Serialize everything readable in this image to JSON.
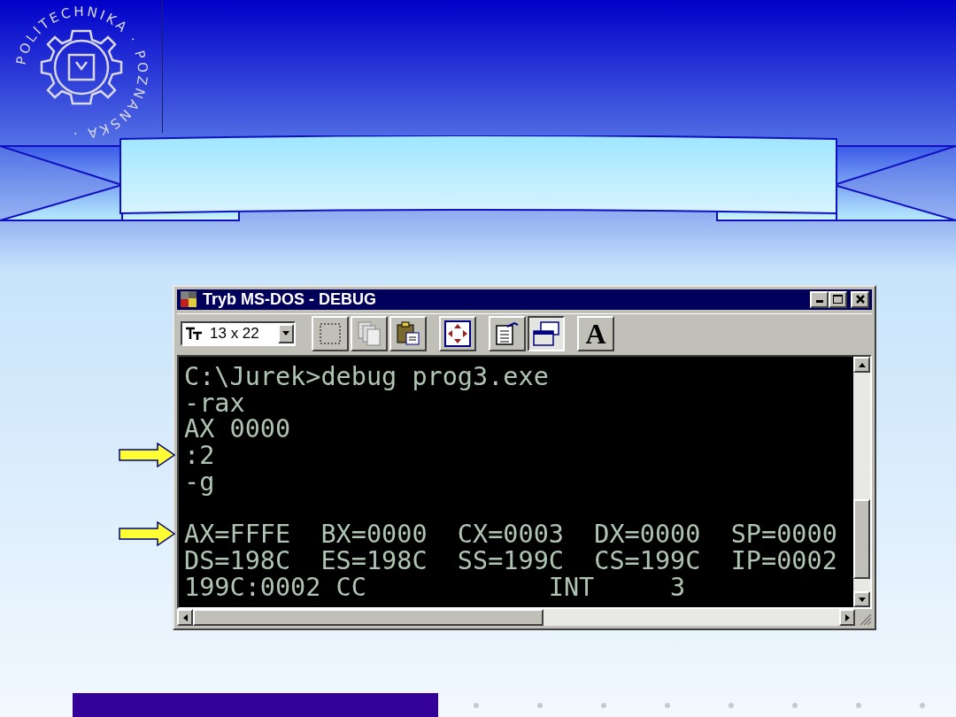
{
  "logo": {
    "text": "POLITECHNIKA · POZNANSKA · "
  },
  "window": {
    "title": "Tryb MS-DOS - DEBUG"
  },
  "toolbar": {
    "font_size": "13 x 22",
    "buttons": [
      {
        "kind": "mark",
        "pressed": false
      },
      {
        "kind": "copy",
        "pressed": false
      },
      {
        "kind": "paste",
        "pressed": false
      },
      {
        "kind": "fullscreen",
        "pressed": false
      },
      {
        "kind": "properties",
        "pressed": false
      },
      {
        "kind": "background",
        "pressed": true
      },
      {
        "kind": "font",
        "label": "A",
        "pressed": false
      }
    ]
  },
  "console": {
    "lines": [
      {
        "kind": "text",
        "text": "C:\\Jurek>debug prog3.exe"
      },
      {
        "kind": "text",
        "text": "-rax"
      },
      {
        "kind": "text",
        "text": "AX 0000"
      },
      {
        "kind": "text",
        "text": ":2",
        "marked": true
      },
      {
        "kind": "text",
        "text": "-g"
      },
      {
        "kind": "blank"
      },
      {
        "kind": "text",
        "text": "AX=FFFE  BX=0000  CX=0003  DX=0000  SP=0000",
        "marked": true
      },
      {
        "kind": "text",
        "text": "DS=198C  ES=198C  SS=199C  CS=199C  IP=0002"
      },
      {
        "kind": "text",
        "text": "199C:0002 CC            INT     3"
      }
    ]
  }
}
